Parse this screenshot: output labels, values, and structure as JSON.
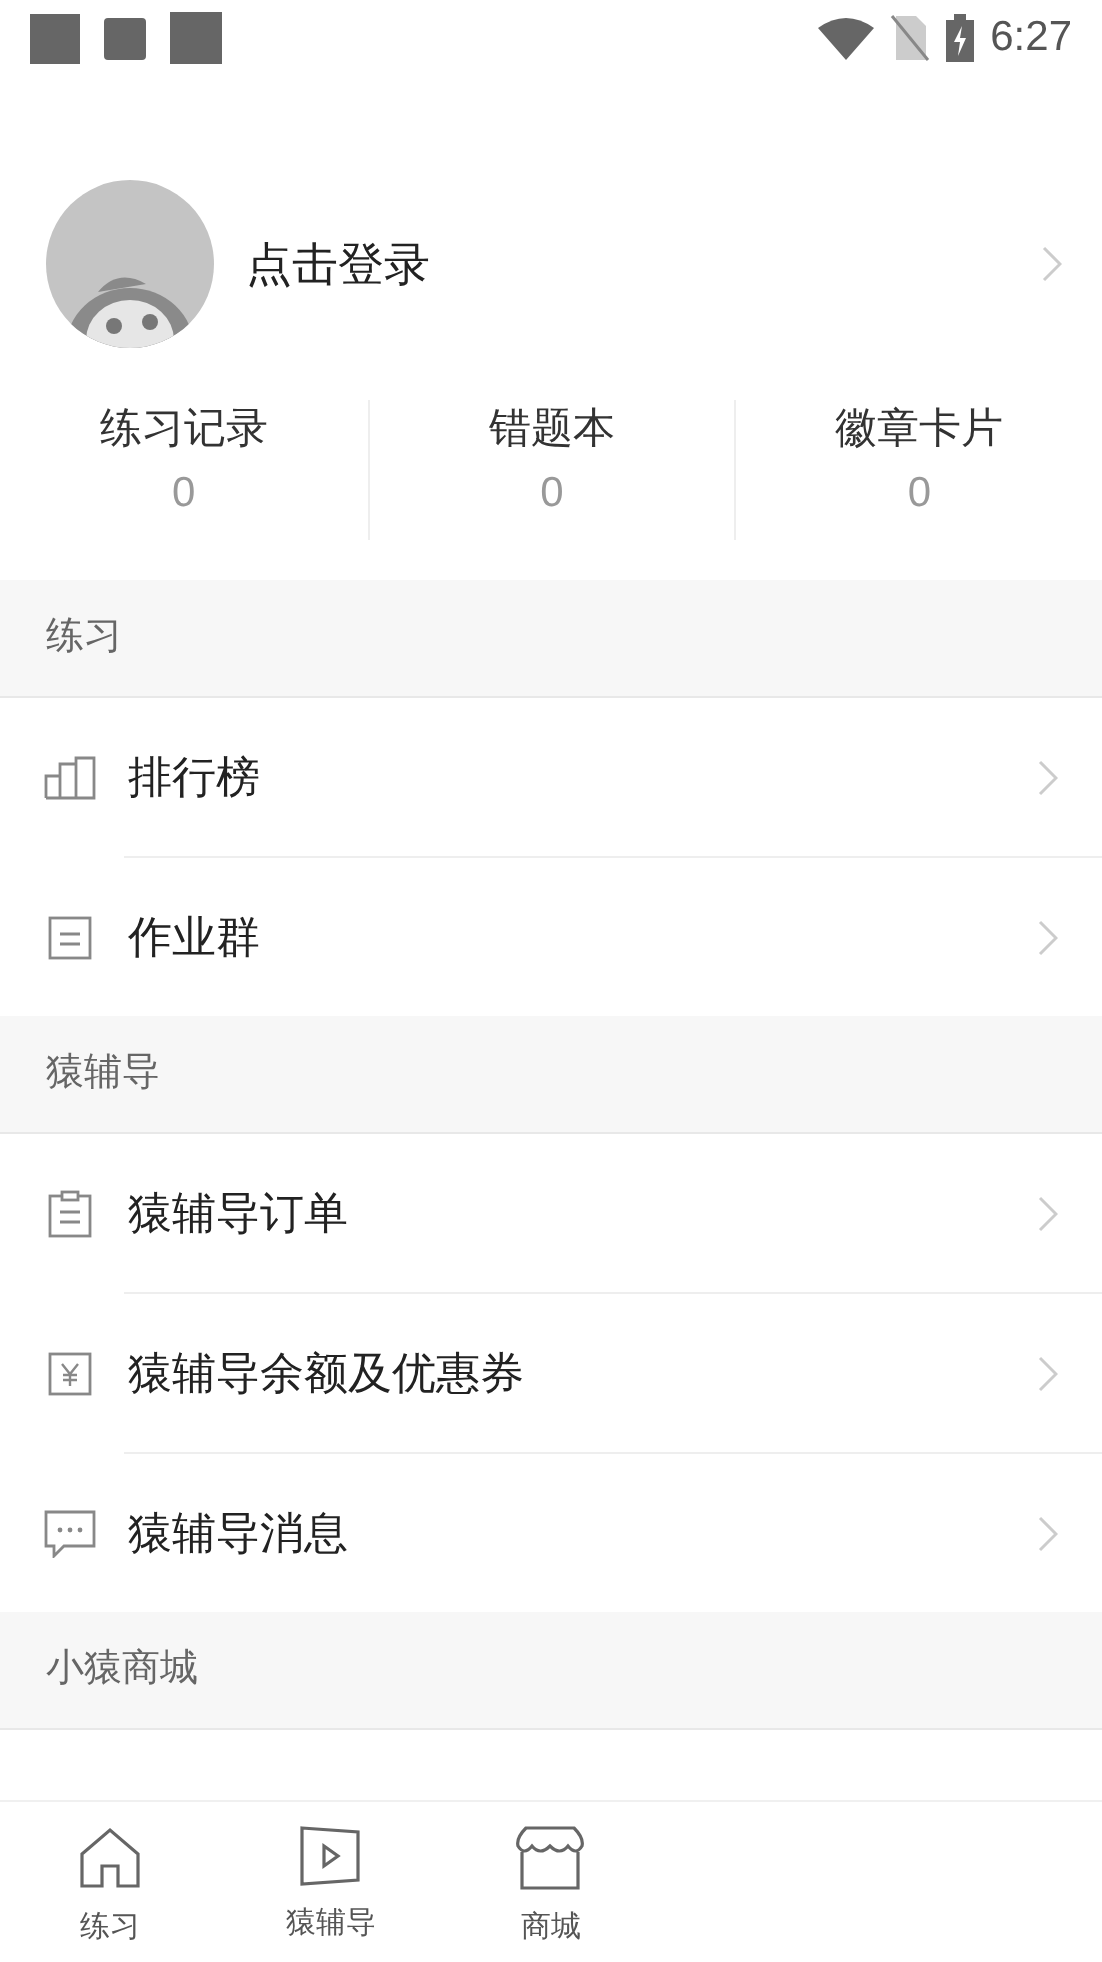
{
  "status_bar": {
    "time": "6:27"
  },
  "profile": {
    "login_label": "点击登录"
  },
  "stats": [
    {
      "label": "练习记录",
      "value": "0"
    },
    {
      "label": "错题本",
      "value": "0"
    },
    {
      "label": "徽章卡片",
      "value": "0"
    }
  ],
  "sections": [
    {
      "title": "练习",
      "items": [
        {
          "label": "排行榜",
          "kind": "chart"
        },
        {
          "label": "作业群",
          "kind": "list"
        }
      ]
    },
    {
      "title": "猿辅导",
      "items": [
        {
          "label": "猿辅导订单",
          "kind": "clipboard"
        },
        {
          "label": "猿辅导余额及优惠券",
          "kind": "yuan"
        },
        {
          "label": "猿辅导消息",
          "kind": "message"
        }
      ]
    },
    {
      "title": "小猿商城"
    }
  ],
  "tab_bar": [
    {
      "label": "练习",
      "kind": "home"
    },
    {
      "label": "猿辅导",
      "kind": "play"
    },
    {
      "label": "商城",
      "kind": "store"
    }
  ]
}
